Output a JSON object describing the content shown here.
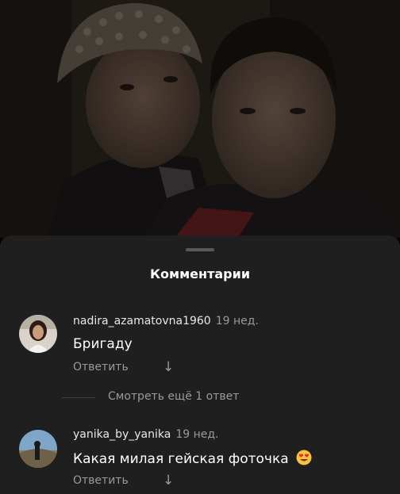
{
  "sheet": {
    "title": "Комментарии",
    "more_replies": "Смотреть ещё 1 ответ"
  },
  "comments": [
    {
      "username": "nadira_azamatovna1960",
      "time": "19 нед.",
      "text": "Бригаду",
      "reply_label": "Ответить"
    },
    {
      "username": "yanika_by_yanika",
      "time": "19 нед.",
      "text": "Какая милая гейская фоточка",
      "reply_label": "Ответить",
      "emoji": "heart-eyes-emoji"
    }
  ],
  "icons": {
    "reply_arrow": "arrow-down-icon"
  }
}
